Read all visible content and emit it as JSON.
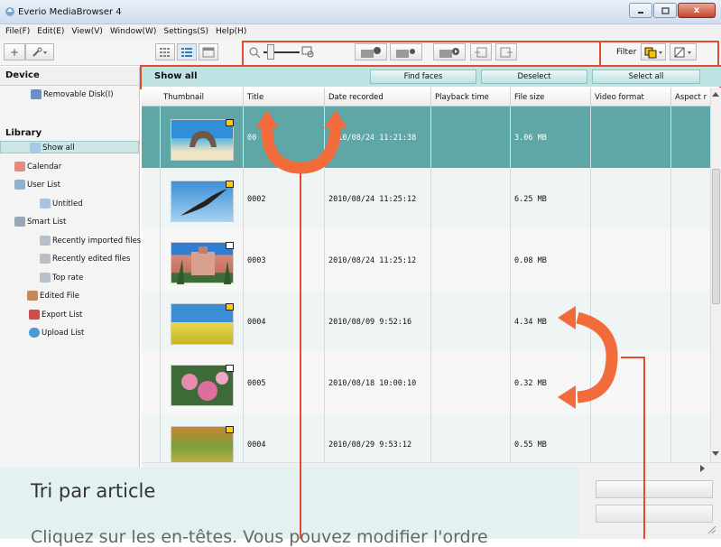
{
  "window": {
    "title": "Everio MediaBrowser 4",
    "close_glyph": "x"
  },
  "menu": [
    "File(F)",
    "Edit(E)",
    "View(V)",
    "Window(W)",
    "Settings(S)",
    "Help(H)"
  ],
  "toolbar": {
    "filter_label": "Filter",
    "add_glyph": "+"
  },
  "sidebar": {
    "device_heading": "Device",
    "device_items": [
      "Removable Disk(I)"
    ],
    "library_heading": "Library",
    "library_items": [
      "Show all",
      "Calendar",
      "User List",
      "Untitled",
      "Smart List",
      "Recently imported files",
      "Recently edited files",
      "Top rate",
      "Edited File",
      "Export List",
      "Upload List"
    ]
  },
  "actionbar": {
    "title": "Show all",
    "find_faces": "Find faces",
    "deselect": "Deselect",
    "select_all": "Select all"
  },
  "columns": [
    "Thumbnail",
    "Title",
    "Date recorded",
    "Playback time",
    "File size",
    "Video format",
    "Aspect r"
  ],
  "rows": [
    {
      "title": "00",
      "date": "2010/08/24 11:21:38",
      "size": "3.06 MB"
    },
    {
      "title": "0002",
      "date": "2010/08/24 11:25:12",
      "size": "6.25 MB"
    },
    {
      "title": "0003",
      "date": "2010/08/24 11:25:12",
      "size": "0.08 MB"
    },
    {
      "title": "0004",
      "date": "2010/08/09 9:52:16",
      "size": "4.34 MB"
    },
    {
      "title": "0005",
      "date": "2010/08/18 10:00:10",
      "size": "0.32 MB"
    },
    {
      "title": "0004",
      "date": "2010/08/29 9:53:12",
      "size": "0.55 MB"
    }
  ],
  "overlay": {
    "title": "Tri par article",
    "text": "Cliquez sur les en-têtes. Vous pouvez modifier l'ordre"
  },
  "colors": {
    "selected_row": "#5fa7a6",
    "action_bar": "#bfe3e3",
    "highlight": "#e24b2d",
    "arrow": "#f26b3a"
  }
}
